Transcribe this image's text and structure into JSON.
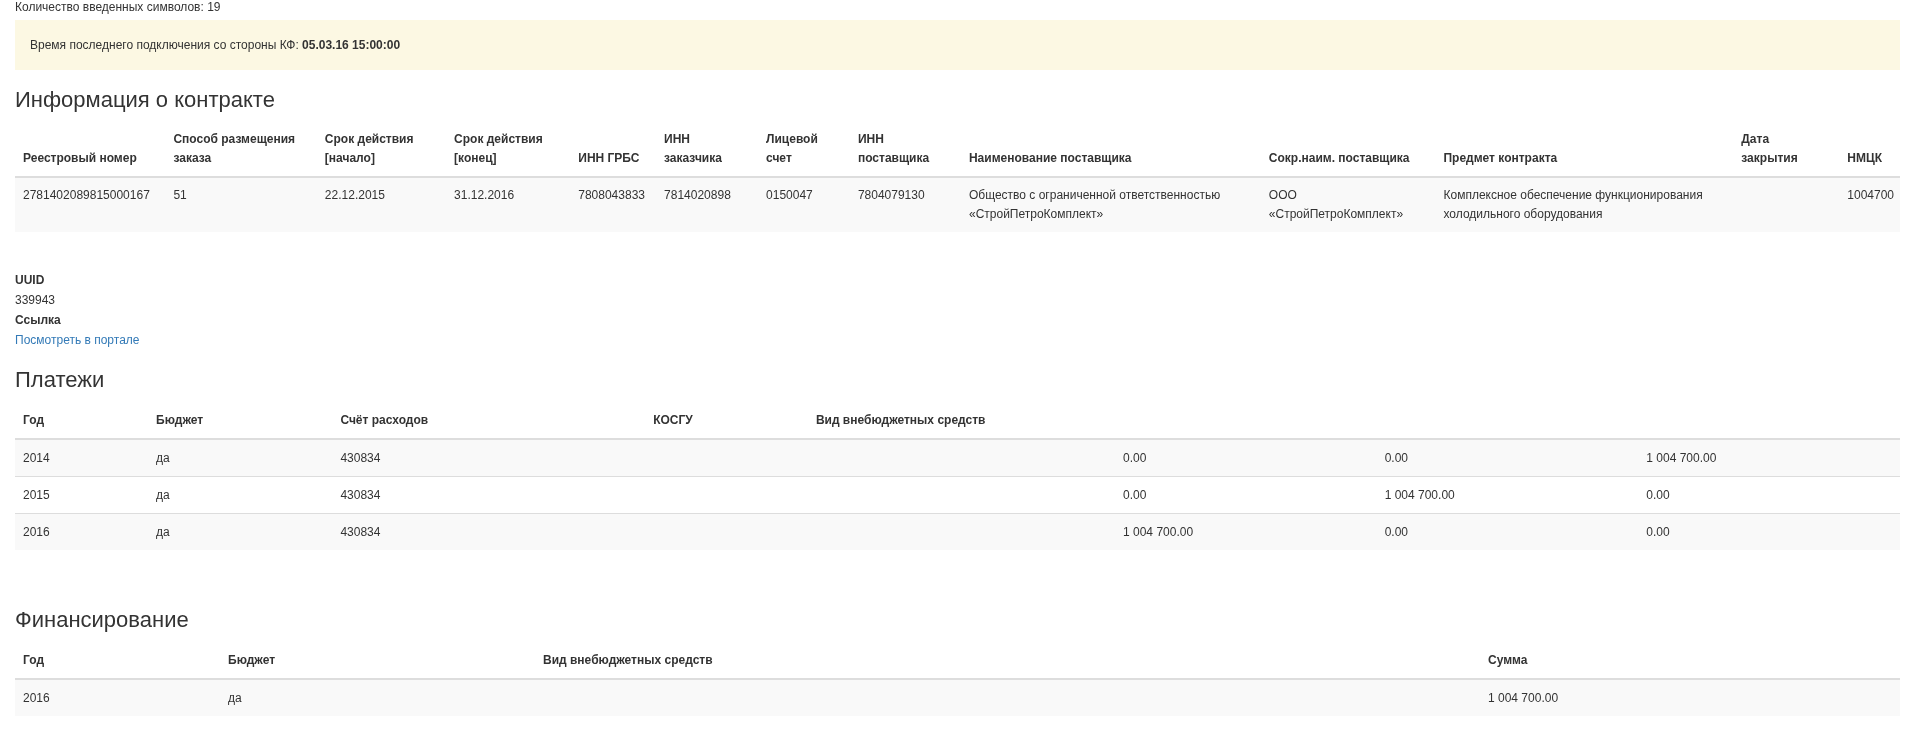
{
  "input_counter": "Количество введенных символов: 19",
  "notice": {
    "label": "Время последнего подключения со стороны КФ:",
    "value": "05.03.16 15:00:00"
  },
  "contract": {
    "title": "Информация о контракте",
    "columns": [
      {
        "line2": "Реестровый номер"
      },
      {
        "line1": "Способ размещения",
        "line2": "заказа"
      },
      {
        "line1": "Срок действия",
        "line2": "[начало]"
      },
      {
        "line1": "Срок действия",
        "line2": "[конец]"
      },
      {
        "line2": "ИНН ГРБС"
      },
      {
        "line1": "ИНН",
        "line2": "заказчика"
      },
      {
        "line1": "Лицевой",
        "line2": "счет"
      },
      {
        "line1": "ИНН",
        "line2": "поставщика"
      },
      {
        "line2": "Наименование поставщика"
      },
      {
        "line2": "Сокр.наим. поставщика"
      },
      {
        "line2": "Предмет контракта"
      },
      {
        "line1": "Дата",
        "line2": "закрытия"
      },
      {
        "line2": "НМЦК"
      }
    ],
    "rows": [
      [
        [
          "2781402089815000167"
        ],
        [
          "51"
        ],
        [
          "22.12.2015"
        ],
        [
          "31.12.2016"
        ],
        [
          "7808043833"
        ],
        [
          "7814020898"
        ],
        [
          "0150047"
        ],
        [
          "7804079130"
        ],
        [
          "Общество с ограниченной ответственностью",
          "«СтройПетроКомплект»"
        ],
        [
          "ООО",
          "«СтройПетроКомплект»"
        ],
        [
          "Комплексное обеспечение функционирования",
          "холодильного оборудования"
        ],
        [],
        [
          "1004700"
        ]
      ]
    ]
  },
  "details": [
    {
      "label": "UUID",
      "value": "339943",
      "kind": "text"
    },
    {
      "label": "Ссылка",
      "value": "Посмотреть в портале",
      "kind": "link"
    }
  ],
  "payments": {
    "title": "Платежи",
    "columns": [
      "Год",
      "Бюджет",
      "Счёт расходов",
      "КОСГУ",
      "Вид внебюджетных средств",
      null,
      null,
      null
    ],
    "rows": [
      [
        "2014",
        "да",
        "430834",
        null,
        null,
        "0.00",
        "0.00",
        "1 004 700.00"
      ],
      [
        "2015",
        "да",
        "430834",
        null,
        null,
        "0.00",
        "1 004 700.00",
        "0.00"
      ],
      [
        "2016",
        "да",
        "430834",
        null,
        null,
        "1 004 700.00",
        "0.00",
        "0.00"
      ]
    ]
  },
  "financing": {
    "title": "Финансирование",
    "columns": [
      "Год",
      "Бюджет",
      "Вид внебюджетных средств",
      "Сумма"
    ],
    "rows": [
      [
        "2016",
        "да",
        null,
        "1 004 700.00"
      ]
    ]
  }
}
